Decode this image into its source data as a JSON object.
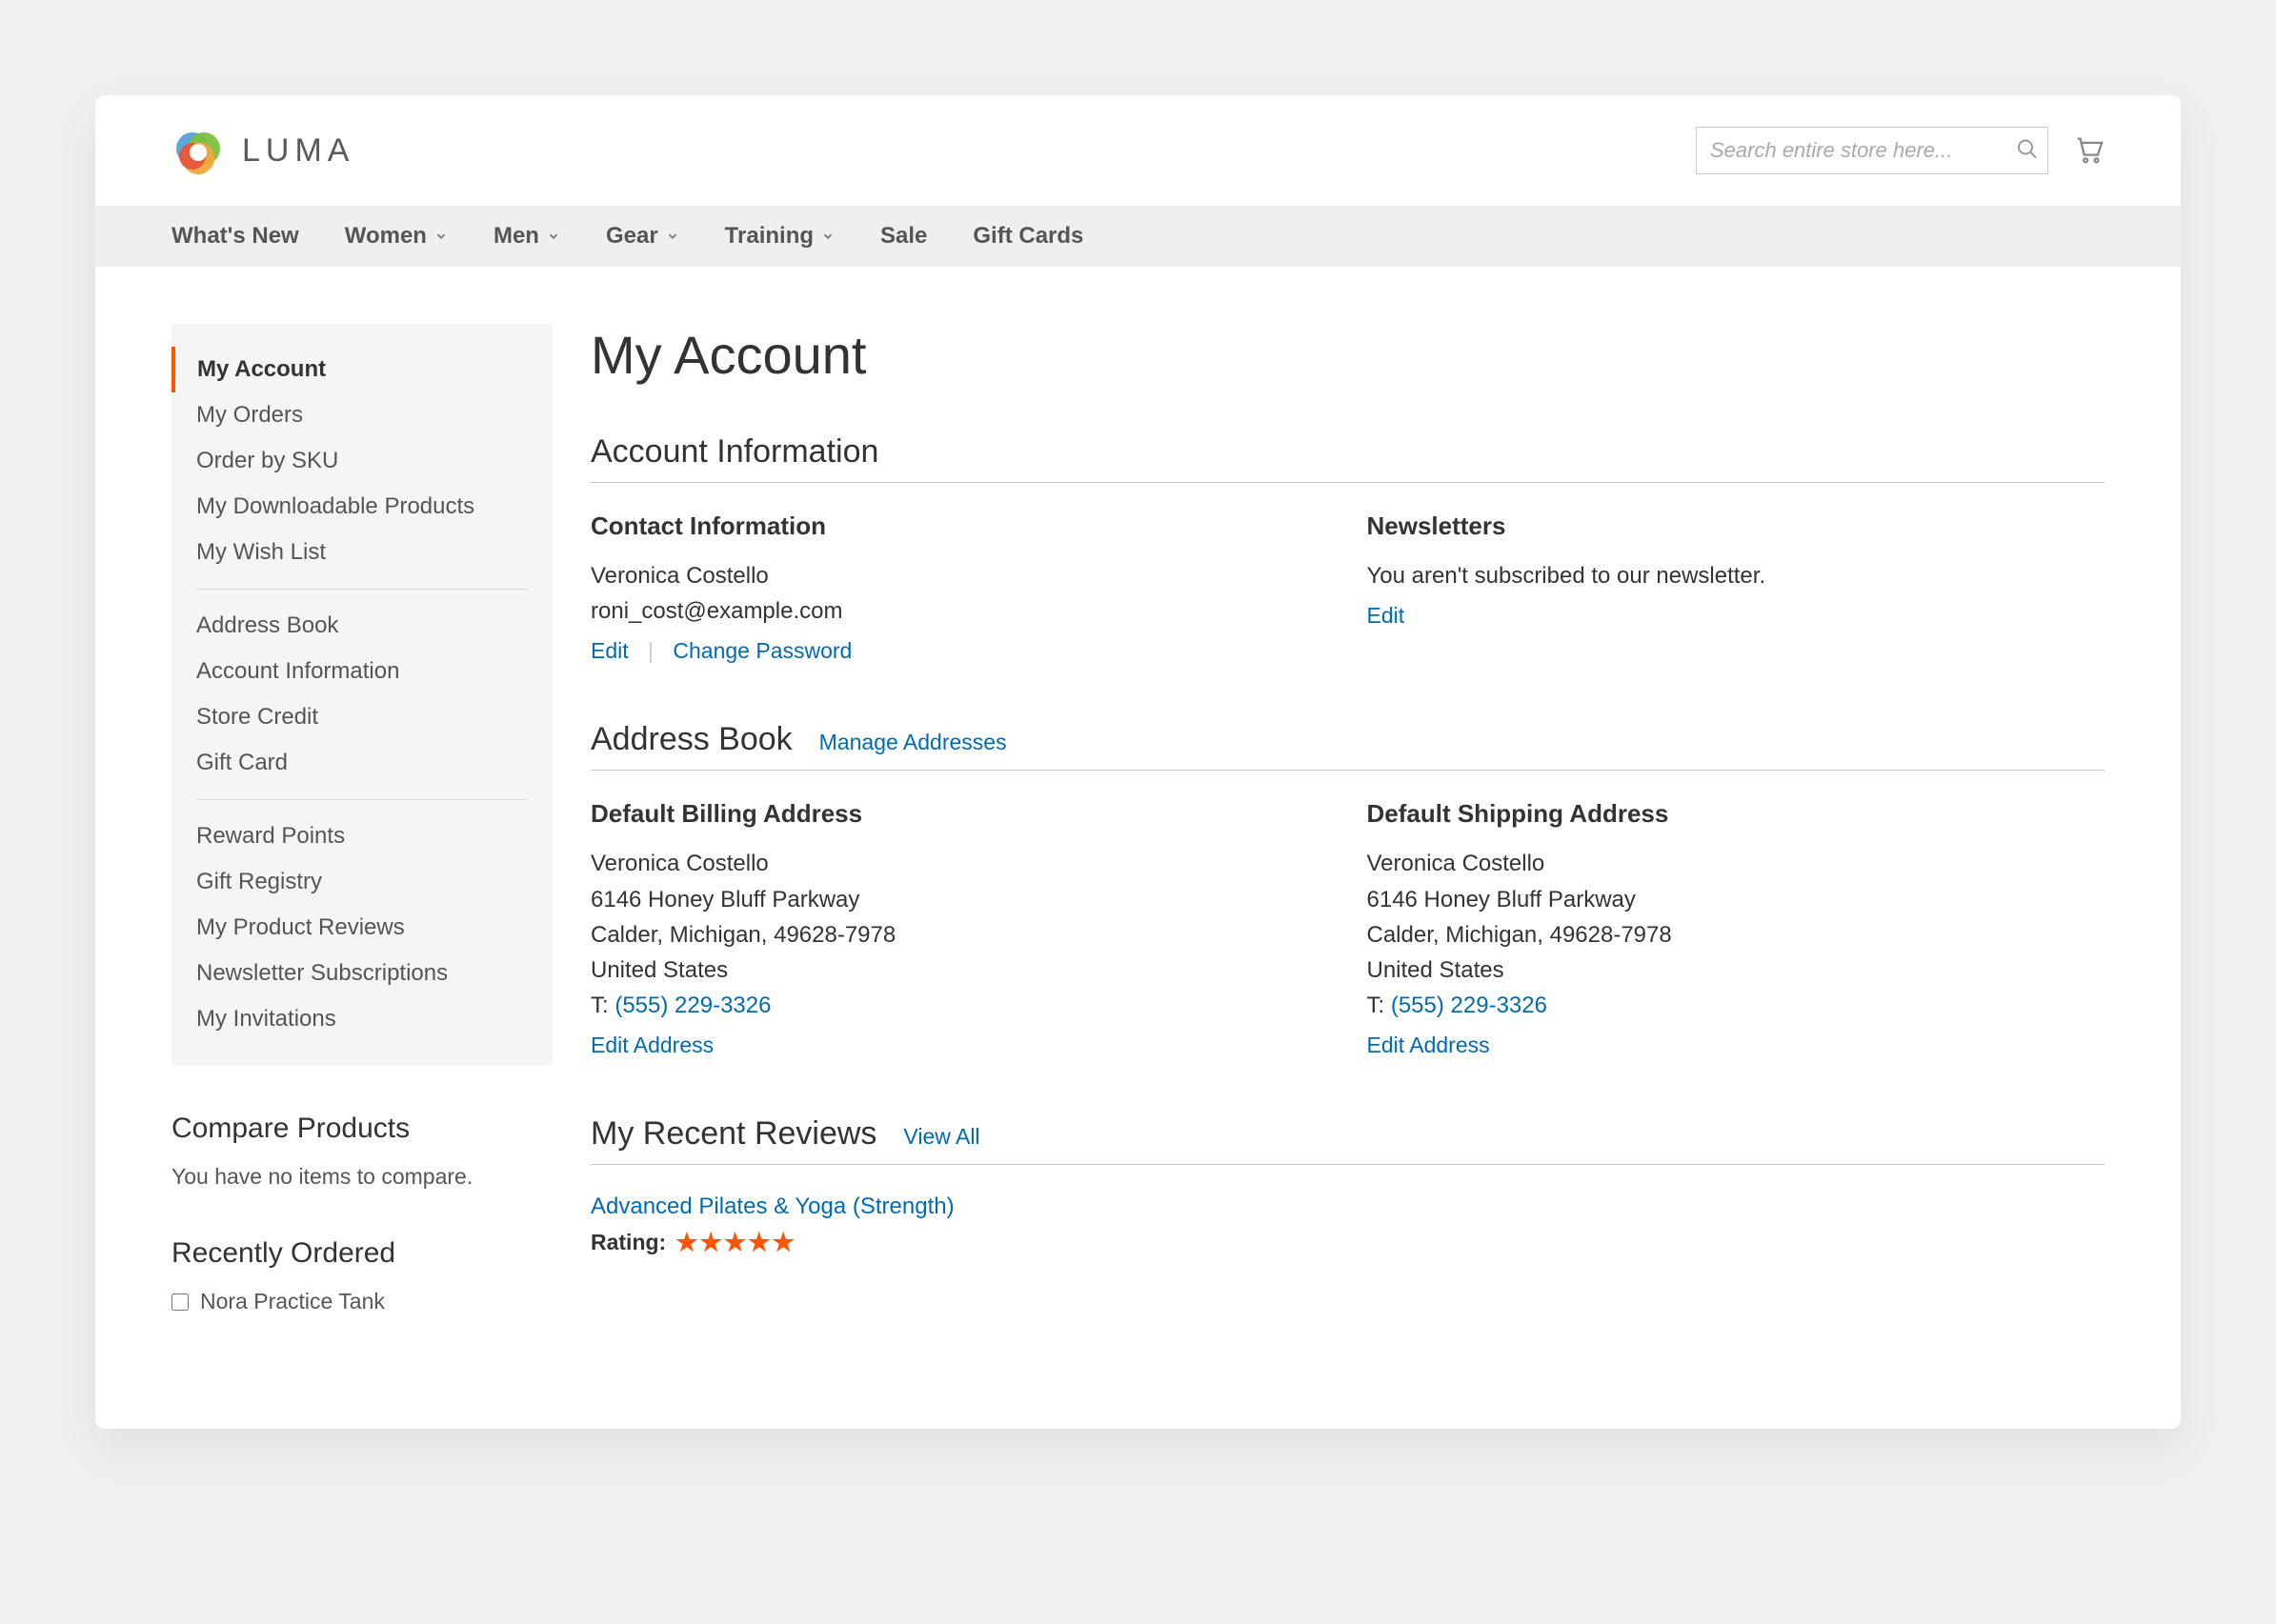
{
  "brand": {
    "name": "LUMA"
  },
  "search": {
    "placeholder": "Search entire store here..."
  },
  "nav": {
    "items": [
      {
        "label": "What's New",
        "dropdown": false
      },
      {
        "label": "Women",
        "dropdown": true
      },
      {
        "label": "Men",
        "dropdown": true
      },
      {
        "label": "Gear",
        "dropdown": true
      },
      {
        "label": "Training",
        "dropdown": true
      },
      {
        "label": "Sale",
        "dropdown": false
      },
      {
        "label": "Gift Cards",
        "dropdown": false
      }
    ]
  },
  "sidebar": {
    "groups": [
      [
        "My Account",
        "My Orders",
        "Order by SKU",
        "My Downloadable Products",
        "My Wish List"
      ],
      [
        "Address Book",
        "Account Information",
        "Store Credit",
        "Gift Card"
      ],
      [
        "Reward Points",
        "Gift Registry",
        "My Product Reviews",
        "Newsletter Subscriptions",
        "My Invitations"
      ]
    ],
    "current": "My Account",
    "compare": {
      "title": "Compare Products",
      "empty": "You have no items to compare."
    },
    "recently_ordered": {
      "title": "Recently Ordered",
      "items": [
        "Nora Practice Tank"
      ]
    }
  },
  "page": {
    "title": "My Account"
  },
  "account_info": {
    "section_title": "Account Information",
    "contact": {
      "title": "Contact Information",
      "name": "Veronica Costello",
      "email": "roni_cost@example.com",
      "edit_label": "Edit",
      "change_pw_label": "Change Password"
    },
    "newsletters": {
      "title": "Newsletters",
      "text": "You aren't subscribed to our newsletter.",
      "edit_label": "Edit"
    }
  },
  "address_book": {
    "section_title": "Address Book",
    "manage_label": "Manage Addresses",
    "billing": {
      "title": "Default Billing Address",
      "name": "Veronica Costello",
      "street": "6146 Honey Bluff Parkway",
      "city_line": "Calder, Michigan, 49628-7978",
      "country": "United States",
      "phone_label": "T: ",
      "phone": "(555) 229-3326",
      "edit_label": "Edit Address"
    },
    "shipping": {
      "title": "Default Shipping Address",
      "name": "Veronica Costello",
      "street": "6146 Honey Bluff Parkway",
      "city_line": "Calder, Michigan, 49628-7978",
      "country": "United States",
      "phone_label": "T: ",
      "phone": "(555) 229-3326",
      "edit_label": "Edit Address"
    }
  },
  "reviews": {
    "section_title": "My Recent Reviews",
    "view_all_label": "View All",
    "items": [
      {
        "product": "Advanced Pilates & Yoga (Strength)",
        "rating_label": "Rating:",
        "stars": 5
      }
    ]
  },
  "colors": {
    "accent": "#ff5501",
    "link": "#006bb4"
  }
}
